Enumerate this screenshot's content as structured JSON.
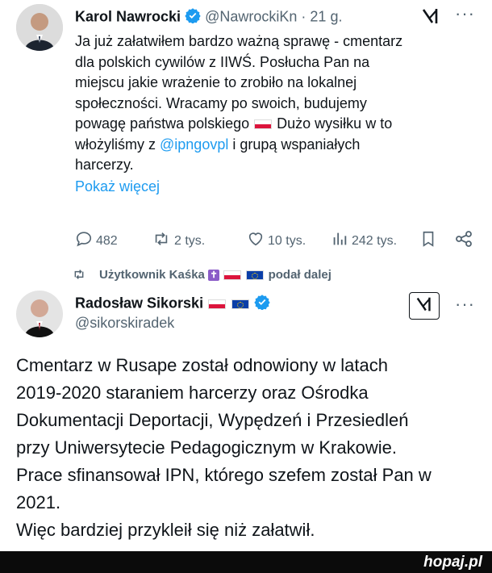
{
  "tweet1": {
    "author_name": "Karol Nawrocki",
    "handle": "@NawrockiKn",
    "separator": "·",
    "time": "21 g.",
    "lines": [
      "Ja już załatwiłem bardzo ważną sprawę - cmentarz",
      "dla polskich cywilów z IIWŚ. Posłucha Pan na",
      "miejscu jakie wrażenie to zrobiło na lokalnej",
      "społeczności. Wracamy po swoich, budujemy"
    ],
    "line5_before": "powagę państwa polskiego ",
    "line5_after": " Dużo wysiłku w to",
    "line6_before": "włożyliśmy z ",
    "mention": "@ipngovpl",
    "line6_after": " i grupą wspaniałych",
    "line7": "harcerzy.",
    "show_more": "Pokaż więcej",
    "actions": {
      "replies": "482",
      "reposts": "2 tys.",
      "likes": "10 tys.",
      "views": "242 tys."
    }
  },
  "repost_banner": {
    "prefix": "Użytkownik Kaśka",
    "suffix": "podał dalej"
  },
  "tweet2": {
    "author_name": "Radosław Sikorski",
    "handle": "@sikorskiradek",
    "lines": [
      "Cmentarz w Rusape został odnowiony w latach",
      "2019-2020 staraniem harcerzy oraz Ośrodka",
      "Dokumentacji Deportacji, Wypędzeń i Przesiedleń",
      "przy Uniwersytecie Pedagogicznym w Krakowie.",
      "Prace sfinansował IPN, którego szefem został Pan w",
      "2021.",
      "Więc bardziej przykleił się niż załatwił."
    ]
  },
  "watermark": "hopaj.pl",
  "colors": {
    "link": "#1d9bf0",
    "muted": "#536471",
    "verified": "#1d9bf0",
    "footer": "#0b0b0b"
  },
  "icons": [
    "verified-badge-icon",
    "grok-icon",
    "more-icon",
    "reply-icon",
    "repost-icon",
    "like-icon",
    "views-icon",
    "bookmark-icon",
    "share-icon",
    "flag-pl-icon",
    "flag-eu-icon",
    "cross-icon"
  ]
}
